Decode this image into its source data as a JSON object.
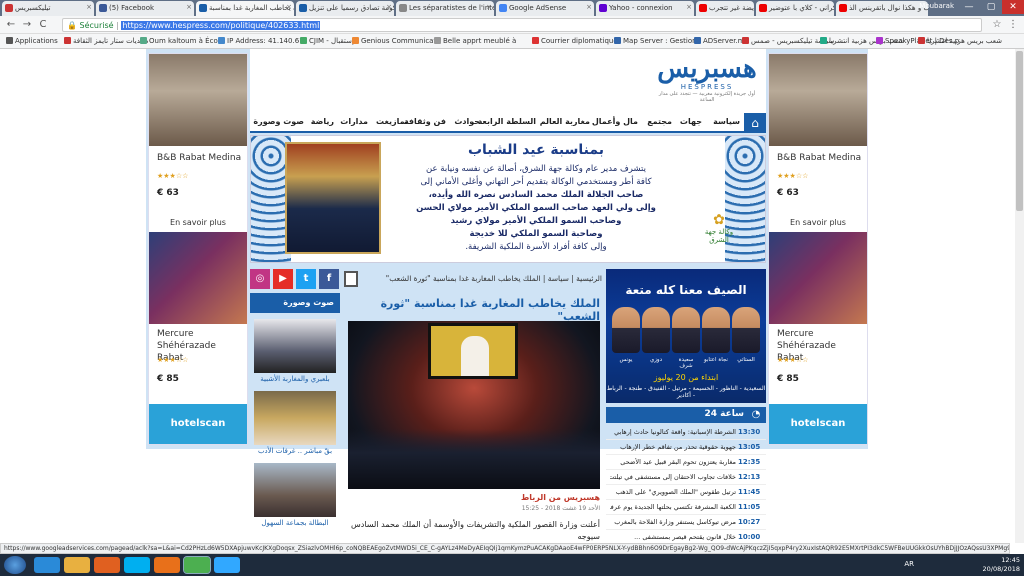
{
  "browser": {
    "tabs": [
      {
        "title": "تيليكسبريس",
        "color": "#c33"
      },
      {
        "title": "(5) Facebook",
        "color": "#3b5998"
      },
      {
        "title": "الملك يخاطب المغاربة غدا بمناسبة",
        "color": "#1a5ea8"
      },
      {
        "title": "الحكومة تصادق رسميا على تنزيل",
        "color": "#1a5ea8"
      },
      {
        "title": "Les séparatistes de l'inté",
        "color": "#888"
      },
      {
        "title": "Google AdSense",
        "color": "#4285f4"
      },
      {
        "title": "Yahoo - connexion",
        "color": "#6001d2"
      },
      {
        "title": "نايضة غير تتجرب",
        "color": "#e00"
      },
      {
        "title": "دنيام الكركراني - كلاي با عتوضير",
        "color": "#e00"
      },
      {
        "title": "تعرف و هكذا نوال باتقرينس الذ...",
        "color": "#e00"
      }
    ],
    "user": "Moubarak",
    "window_min": "—",
    "window_max": "▢",
    "window_close": "✕",
    "back": "←",
    "forward": "→",
    "reload": "C",
    "home": "⌂",
    "secure_label": "Sécurisé",
    "url": "https://www.hespress.com/politique/402633.html",
    "bookmarks": [
      "Applications",
      "منتديات ستار تايمز الثقافة",
      "Oum kaltoum à Écou",
      "IP Address: 41.140.61",
      "CJIM - إستقبال",
      "Genious Communicat",
      "Belle apprt meublé à",
      "Courrier diplomatique",
      "Map Server : Gestion",
      "ADServer.ma",
      "سياسة تيليكسبريس - صمس",
      "شعب بريس هزبية انتشريا",
      "SpeakyPlanet | Des p",
      "شعب بريس هزبية انتشريا"
    ]
  },
  "side_ads": {
    "hotels": [
      {
        "name": "B&B Rabat Medina",
        "stars": "★★★☆☆",
        "price": "€ 63"
      },
      {
        "name": "Mercure Shéhérazade Rabat",
        "stars": "★★★☆☆",
        "price": "€ 85"
      }
    ],
    "more": "En savoir plus",
    "brand": "hotelscan"
  },
  "site": {
    "logo_ar": "هسبريس",
    "logo_en": "HESPRESS",
    "tagline": "أول جريدة إلكترونية مغربية — تتجدد على مدار الساعة",
    "nav": [
      "سياسة",
      "جهات",
      "مجتمع",
      "مال وأعمال",
      "مغاربة العالم",
      "السلطة الرابعة",
      "حوادث",
      "فن وثقافة",
      "تمازيغت",
      "مدارات",
      "رياضة",
      "صوت وصورة"
    ]
  },
  "banner": {
    "title": "بمناسبة عيد الشباب",
    "lines": [
      "يتشرف مدير عام وكالة جهة الشرق، أصالة عن نفسه ونيابة عن",
      "كافة أطر ومستخدمي الوكالة بتقديم أحر التهاني وأغلى الأماني إلى",
      "صاحب الجلالة الملك محمد السادس نصره الله وأيده،",
      "وإلى ولي العهد صاحب السمو الملكي الأمير مولاي الحسن",
      "وصاحب السمو الملكي الأمير مولاي رشيد",
      "وصاحبة السمو الملكي للا خديجة",
      "وإلى كافة أفراد الأسرة الملكية الشريفة."
    ],
    "logo_text": "وكالة جهة الشرق"
  },
  "breadcrumb": "الرئيسية | سياسة | الملك يخاطب المغاربة غدا بمناسبة \"ثورة الشعب\"",
  "social": [
    {
      "name": "instagram",
      "glyph": "◎",
      "color": "#c13584"
    },
    {
      "name": "youtube",
      "glyph": "▶",
      "color": "#e52d27"
    },
    {
      "name": "twitter",
      "glyph": "t",
      "color": "#1da1f2"
    },
    {
      "name": "facebook",
      "glyph": "f",
      "color": "#3b5998"
    }
  ],
  "video_column": {
    "heading": "صوت وصورة",
    "items": [
      {
        "label": "بلعبري والمغاربة الأشبية",
        "bg": "#6a6a7a"
      },
      {
        "label": "بقّ مباشر .. غرفات الأدب",
        "bg": "#b89a5a"
      },
      {
        "label": "البطالة بجماعة السهول",
        "bg": "#8a9aa8"
      }
    ]
  },
  "article": {
    "title": "الملك يخاطب المغاربة غدا بمناسبة \"ثورة الشعب\"",
    "region": "هسبريس من الرباط",
    "date": "الأحد 19 غشت 2018 - 15:25",
    "lead": "أعلنت وزارة القصور الملكية والتشريفات والأوسمة أن الملك محمد السادس سيوجه"
  },
  "promo": {
    "headline": "الصيف معنا كله متعة",
    "subline": "ابتداء من 20 يوليوز",
    "cities": "السعيدية - الناظور - الحسيمة - مرتيل - الفنيدق - طنجة - الرباط - أكادير",
    "artists": [
      "يونس",
      "دوزي",
      "سعيدة شرف",
      "نجاة اعتابو",
      "الستاتي"
    ]
  },
  "news24": {
    "heading": "24 ساعة",
    "items": [
      {
        "time": "13:30",
        "text": "الشرطة الإسبانية: واقعة كتالونيا حادث إرهابي"
      },
      {
        "time": "13:05",
        "text": "جهوية حقوقية تحذر من تفاقم خطر الإرهاب"
      },
      {
        "time": "12:35",
        "text": "مغاربة يعتزون تحوم البقر قبيل عيد الأضحى"
      },
      {
        "time": "12:13",
        "text": "خلافات تجاوب الاحتقان إلى مستشفى في تيلتت"
      },
      {
        "time": "11:45",
        "text": "ترتيل طقوس \"الملك الصوويري\" على الذهب"
      },
      {
        "time": "11:05",
        "text": "الكعبة المشرفة تكتسي بحلتها الجديدة يوم عرفة"
      },
      {
        "time": "10:27",
        "text": "مرض تيوكاسل يستنفر وزارة الفلاحة بالمغرب"
      },
      {
        "time": "10:00",
        "text": "خلال قانون يقتحم قيصر بمستشفى ..."
      }
    ]
  },
  "status_url": "https://www.googleadservices.com/pagead/aclk?sa=L&ai=Cd2PHzLd6W5DXApjuwvKcJKXgDoqsx_ZSiazlvOMHl6p_coNQBEAEgoZvtMWD5i_CE_C-gAYLz4MeDyAEIqQIj1qmKymzPuACAKgDAaoE4wFP0ERP5NLX-Y-ydBBhn6O9DrEgayBg2-Wg_QO9-dWcAjPKqczZjI5qxpP4ry2XuxIstAQR92E5MXrtPI3dkC5WFBeUUGkkOsUYhBDjJJOzAQssU3XPMg9WN8U8R...",
  "taskbar": {
    "lang": "AR",
    "time": "12:45",
    "date": "20/08/2018",
    "icons": [
      {
        "name": "ie",
        "color": "#2a8ad8"
      },
      {
        "name": "explorer",
        "color": "#e8b040"
      },
      {
        "name": "media",
        "color": "#e06020"
      },
      {
        "name": "skype",
        "color": "#00aff0"
      },
      {
        "name": "firefox",
        "color": "#e8701a"
      },
      {
        "name": "chrome",
        "color": "#4caf50"
      },
      {
        "name": "photoshop",
        "color": "#31a8ff"
      }
    ]
  }
}
